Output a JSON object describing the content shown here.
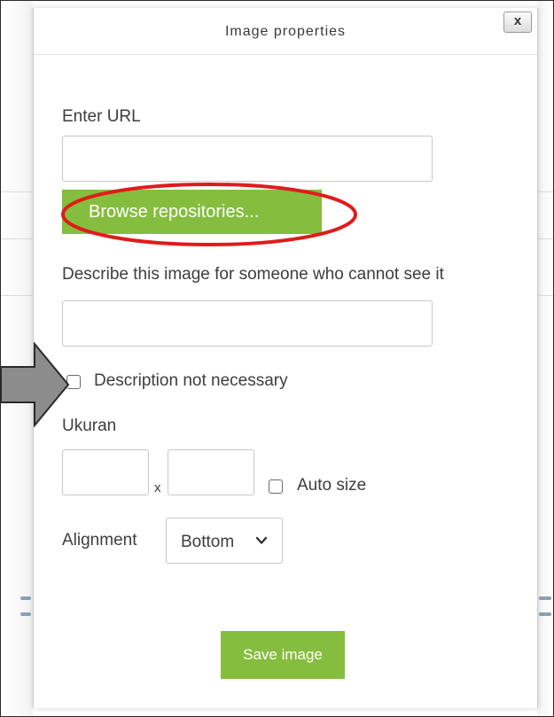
{
  "dialog": {
    "title": "Image properties",
    "close_label": "x"
  },
  "form": {
    "url_label": "Enter URL",
    "url_value": "",
    "browse_label": "Browse repositories...",
    "description_label": "Describe this image for someone who cannot see it",
    "description_value": "",
    "description_not_necessary_label": "Description not necessary",
    "description_not_necessary_checked": false,
    "size_label": "Ukuran",
    "width_value": "",
    "height_value": "",
    "size_separator": "x",
    "auto_size_label": "Auto size",
    "auto_size_checked": false,
    "alignment_label": "Alignment",
    "alignment_value": "Bottom",
    "save_label": "Save image"
  },
  "annotations": {
    "highlight_color": "#e01b1b",
    "arrow_color": "#8c8c8c"
  },
  "colors": {
    "accent_green": "#85bd3e"
  },
  "icons": {
    "close": "close-icon",
    "chevron": "chevron-down-icon",
    "pointer": "arrow-right-icon"
  }
}
